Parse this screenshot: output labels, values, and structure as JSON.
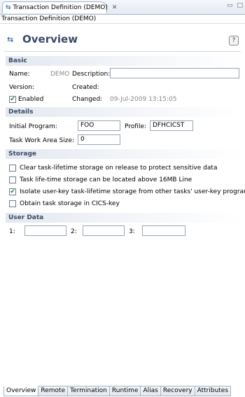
{
  "window": {
    "tab_title": "Transaction Definition (DEMO)",
    "breadcrumb": "Transaction Definition (DEMO)"
  },
  "header": {
    "title": "Overview",
    "help_label": "?"
  },
  "basic": {
    "section_title": "Basic",
    "name_label": "Name:",
    "name_value": "DEMO",
    "description_label": "Description:",
    "description_value": "",
    "version_label": "Version:",
    "created_label": "Created:",
    "enabled_label": "Enabled",
    "enabled_checked": true,
    "changed_label": "Changed:",
    "changed_value": "09-Jul-2009 13:15:05"
  },
  "details": {
    "section_title": "Details",
    "initial_program_label": "Initial Program:",
    "initial_program_value": "FOO",
    "profile_label": "Profile:",
    "profile_value": "DFHCICST",
    "twa_label": "Task Work Area Size:",
    "twa_value": "0"
  },
  "storage": {
    "section_title": "Storage",
    "options": [
      {
        "label": "Clear task-lifetime storage on release to protect sensitive data",
        "checked": false
      },
      {
        "label": "Task life-time storage can be located above 16MB Line",
        "checked": false
      },
      {
        "label": "Isolate user-key task-lifetime storage from other tasks' user-key programs",
        "checked": true
      },
      {
        "label": "Obtain task storage in CICS-key",
        "checked": false
      }
    ]
  },
  "user_data": {
    "section_title": "User Data",
    "fields": [
      {
        "label": "1:",
        "value": ""
      },
      {
        "label": "2:",
        "value": ""
      },
      {
        "label": "3:",
        "value": ""
      }
    ]
  },
  "bottom_tabs": [
    "Overview",
    "Remote",
    "Termination",
    "Runtime",
    "Alias",
    "Recovery",
    "Attributes"
  ]
}
